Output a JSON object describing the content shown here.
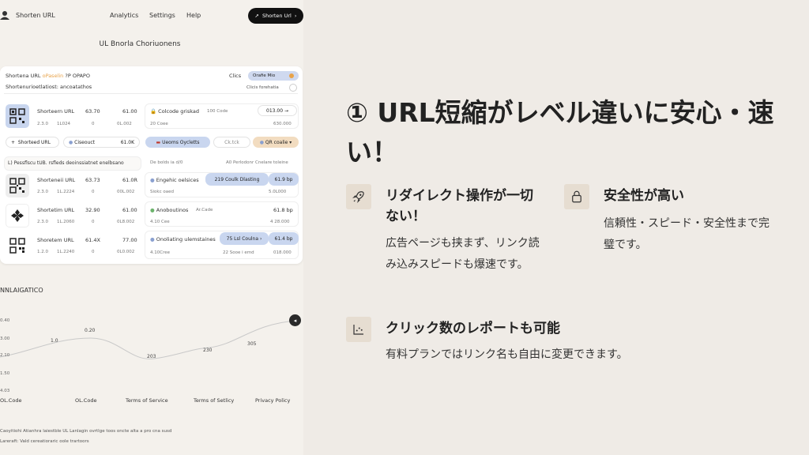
{
  "mockup": {
    "nav": {
      "brand": "Shorten URL",
      "items": [
        "Analytics",
        "Settings",
        "Help"
      ],
      "cta": "Shorten Url"
    },
    "title": "UL Bnorla Choriuonens",
    "card": {
      "header_left": "Shortena URL",
      "header_left_accent": "oPaselin",
      "header_left_tail": "?P OPAPO",
      "clics": "Clics",
      "pill": "Orafie Mio",
      "sub": "Shortenurioetlatiost: ancoatathos",
      "sub_right": "Clicis forehatia",
      "row1": {
        "name": "Shorteern URL",
        "a": "63.70",
        "b": "61.00",
        "m1": "2.3.0",
        "m2": "1L024",
        "m3": "0",
        "m4": "0L.002"
      },
      "right1": {
        "name": "Colcode griskad",
        "tag": "100 Code",
        "val": "013.00",
        "sub1": "20 Coee",
        "sub2": "630.000"
      },
      "tools": {
        "shorted": "Shorteed URL",
        "clear": "Ciseouct",
        "val": "61.0K",
        "p1": "Ueoms Oycletts",
        "p2": "Ck.tck",
        "p3": "QR coalie"
      },
      "band": "L) Pessflscu tUB. rsfleds deoinssiatnet enelbsano",
      "band_right1": "De bolds ia d/0",
      "band_right2": "A0 Perlodonr Cnelare toleine",
      "row2": {
        "name": "Shorteneii URL",
        "a": "63.73",
        "b": "61.0R",
        "m1": "2.3.0",
        "m2": "1L.2224",
        "m3": "0",
        "m4": "00L.002"
      },
      "right2": {
        "name": "Engehic oelsices",
        "tag": "219 Coulk Dlasting",
        "val": "61.9 bp",
        "sub1": "Siokc oaed",
        "sub2": "5.0L000"
      },
      "row3": {
        "name": "Shortetim URL",
        "a": "32.90",
        "b": "61.00",
        "m1": "2.3.0",
        "m2": "1L.2060",
        "m3": "0",
        "m4": "0L8.002"
      },
      "right3": {
        "name": "Anoboutinos",
        "tag": "Ar.Cade",
        "val": "61.8 bp",
        "sub1": "4.10 Cee",
        "sub2": "4 28.000"
      },
      "row4": {
        "name": "Shoretem URL",
        "a": "61.4X",
        "b": "77.00",
        "m1": "1.2.0",
        "m2": "1L.2240",
        "m3": "0",
        "m4": "0L0.002"
      },
      "right4": {
        "name": "Onoliating ulemstaines",
        "tag": "75 Lsl Coulna",
        "val": "61.4 bp",
        "sub1": "4.10Cree",
        "sub2": "018.000",
        "sub3": "22 Sooe i emd"
      }
    },
    "section": "NNLAIGATICO",
    "chart_labels": {
      "y": [
        "0.40",
        "3.00",
        "2.10",
        "1.50",
        "4.03"
      ],
      "points": [
        "1.0",
        "0.20",
        "203",
        "230",
        "305"
      ],
      "x": [
        "OL.Code",
        "OL.Code",
        "Terms of Service",
        "Terms of Setlicy",
        "Privacy Policy"
      ]
    },
    "footer": [
      "Caoyitiohi Atianhra laiestble UL Lanlagin ovrtlge toos oncte alta a pro cna susd",
      "Lareraft: Vald cereatioraric oole trartoors"
    ]
  },
  "content": {
    "headline": "① URL短縮がレベル違いに安心・速い！",
    "features": [
      {
        "icon": "rocket-icon",
        "title": "リダイレクト操作が一切ない！",
        "desc": "広告ページも挟まず、リンク読み込みスピードも爆速です。"
      },
      {
        "icon": "lock-icon",
        "title": "安全性が高い",
        "desc": "信頼性・スピード・安全性まで完璧です。"
      },
      {
        "icon": "chart-icon",
        "title": "クリック数のレポートも可能",
        "desc": "有料プランではリンク名も自由に変更できます。"
      }
    ]
  },
  "colors": {
    "accent_blue": "#c9d6ef",
    "accent_orange": "#e8a34a",
    "icon_bg": "#e6ddd1",
    "bg": "#efebe6"
  }
}
